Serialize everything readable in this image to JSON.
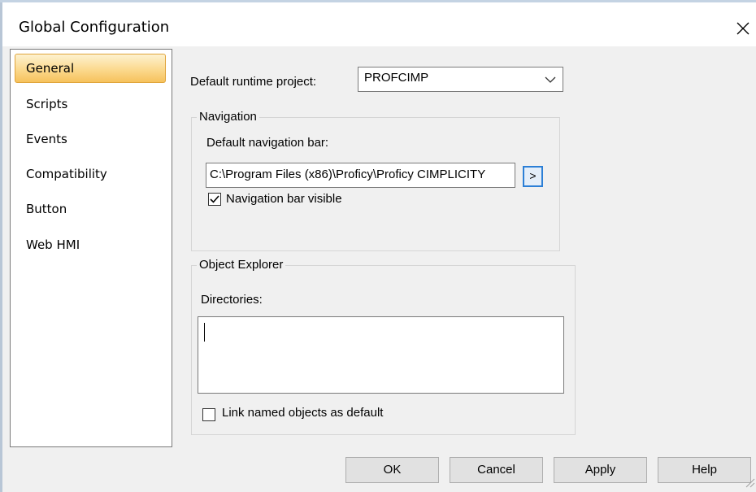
{
  "window": {
    "title": "Global Configuration",
    "close_glyph": "✕"
  },
  "sidebar": {
    "items": [
      {
        "label": "General",
        "selected": true
      },
      {
        "label": "Scripts"
      },
      {
        "label": "Events"
      },
      {
        "label": "Compatibility"
      },
      {
        "label": "Button"
      },
      {
        "label": "Web HMI"
      }
    ]
  },
  "general": {
    "runtime_project_label": "Default runtime project:",
    "runtime_project_value": "PROFCIMP",
    "navigation": {
      "group_title": "Navigation",
      "nav_bar_label": "Default navigation bar:",
      "nav_bar_path": "C:\\Program Files (x86)\\Proficy\\Proficy CIMPLICITY",
      "browse_label": ">",
      "visible_checkbox_label": "Navigation bar visible",
      "visible_checked": true
    },
    "object_explorer": {
      "group_title": "Object Explorer",
      "directories_label": "Directories:",
      "directories_value": "",
      "link_checkbox_label": "Link named objects as default",
      "link_checked": false
    }
  },
  "buttons": {
    "ok": "OK",
    "cancel": "Cancel",
    "apply": "Apply",
    "help": "Help"
  },
  "colors": {
    "selected_item": "#f6c25c",
    "browse_border": "#2c7fd6"
  }
}
